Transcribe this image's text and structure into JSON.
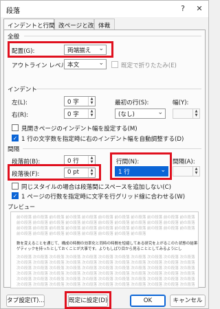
{
  "window": {
    "title": "段落",
    "help": "?",
    "close": "✕"
  },
  "tabs": [
    {
      "label": "インデントと行間隔"
    },
    {
      "label": "改ページと改行"
    },
    {
      "label": "体裁"
    }
  ],
  "general": {
    "heading": "全般",
    "alignment_label": "配置(G):",
    "alignment_value": "両端揃え",
    "outline_label": "アウトライン レベル(O):",
    "outline_value": "本文",
    "collapse_label": "既定で折りたたみ(E)"
  },
  "indent": {
    "heading": "インデント",
    "left_label": "左(L):",
    "left_value": "0 字",
    "right_label": "右(R):",
    "right_value": "0 字",
    "first_line_label": "最初の行(S):",
    "first_line_value": "(なし)",
    "width_label": "幅(Y):",
    "width_value": "",
    "mirror_label": "見開きページのインデント幅を設定する(M)",
    "auto_adjust_label": "1 行の文字数を指定時に右のインデント幅を自動調整する(D)"
  },
  "spacing": {
    "heading": "間隔",
    "before_label": "段落前(B):",
    "before_value": "0 行",
    "after_label": "段落後(F):",
    "after_value": "0 pt",
    "line_spacing_label": "行間(N):",
    "line_spacing_value": "1 行",
    "at_label": "間隔(A):",
    "at_value": "",
    "same_style_label": "同じスタイルの場合は段落間にスペースを追加しない(C)",
    "grid_label": "1 ページの行数を指定時に文字を行グリッド線に合わせる(W)"
  },
  "preview": {
    "heading": "プレビュー",
    "gray_before": [
      "前の段落 前の段落 前の段落 前の段落 前の段落 前の段落 前の段落 前の段落 前の段落 前の段落 前の段落",
      "前の段落 前の段落 前の段落 前の段落 前の段落 前の段落 前の段落 前の段落 前の段落 前の段落 前の段落",
      "前の段落 前の段落 前の段落 前の段落 前の段落 前の段落 前の段落 前の段落 前の段落 前の段落 前の段落",
      "前の段落 前の段落 前の段落 前の段落 前の段落 前の段落 前の段落 前の段落"
    ],
    "sample": [
      "数を変えることを通じて、構成の時間の効率化と同時の時間を短縮してある研究を上がるこのた状態の結果ページ",
      "ゲティックを持ったとしておくことが大事です。よりもしばり目から見ることとしてみるようにし"
    ],
    "gray_after": [
      "次の段落 次の段落 次の段落 次の段落 次の段落 次の段落 次の段落 次の段落 次の段落 次の段落 次の段落",
      "次の段落 次の段落 次の段落 次の段落 次の段落 次の段落 次の段落 次の段落 次の段落 次の段落 次の段落",
      "次の段落 次の段落 次の段落 次の段落 次の段落 次の段落 次の段落 次の段落 次の段落 次の段落 次の段落",
      "次の段落 次の段落 次の段落 次の段落 次の段落 次の段落 次の段落 次の段落 次の段落 次の段落 次の段落",
      "次の段落 次の段落 次の段落 次の段落 次の段落 次の段落 次の段落 次の段落 次の段落 次の段落 次の段落",
      "次の段落 次の段落 次の段落 次の段落 次の段落 次の段落 次の段落 次の段落 次の段落 次の段落 次の段落"
    ]
  },
  "buttons": {
    "tabs": "タブ設定(T)...",
    "default": "既定に設定(D)",
    "ok": "OK",
    "cancel": "キャンセル"
  },
  "colors": {
    "highlight": "#e0101e",
    "accent": "#0a64d6"
  }
}
